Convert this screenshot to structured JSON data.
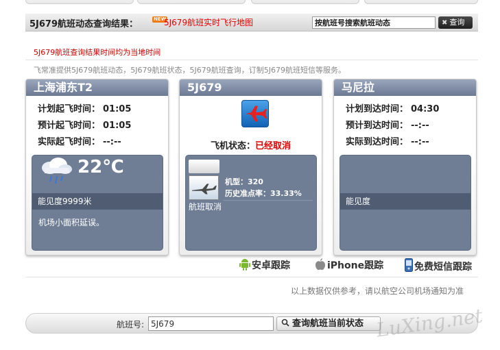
{
  "header": {
    "title": "5J679航班动态查询结果：",
    "new_badge": "NEW",
    "map_link": "5J679航班实时飞行地图",
    "search_input_value": "按航班号搜索航班动态",
    "query_button": "查询"
  },
  "notice": "5J679航班查询结果时间均为当地时间",
  "description": "飞常准提供5J679航班动态，5J679航班状态，5J679航班查询，订制5J679航班短信等服务。",
  "departure": {
    "airport": "上海浦东T2",
    "rows": [
      {
        "label": "计划起飞时间：",
        "value": "01:05"
      },
      {
        "label": "预计起飞时间：",
        "value": "01:05"
      },
      {
        "label": "实际起飞时间：",
        "value": "--:--"
      }
    ],
    "weather": {
      "temperature": "22℃",
      "visibility": "能见度9999米",
      "note": "机场小面积延误。"
    }
  },
  "flight": {
    "number": "5J679",
    "status_label": "飞机状态：",
    "status_value": "已经取消",
    "aircraft_type": "机型：320",
    "on_time_rate": "历史准点率：33.33%",
    "cancel_text": "航班取消"
  },
  "arrival": {
    "airport": "马尼拉",
    "rows": [
      {
        "label": "计划到达时间：",
        "value": "04:30"
      },
      {
        "label": "预计到达时间：",
        "value": "--:--"
      },
      {
        "label": "实际到达时间：",
        "value": "--:--"
      }
    ],
    "weather": {
      "visibility": "能见度"
    }
  },
  "tracking": {
    "android": "安卓跟踪",
    "iphone": "iPhone跟踪",
    "sms": "免费短信跟踪"
  },
  "disclaimer": "以上数据仅供参考，请以航空公司机场通知为准",
  "bottom_search": {
    "label": "航班号:",
    "value": "5J679",
    "button": "查询航班当前状态"
  },
  "watermark": "LuXing.net",
  "colors": {
    "accent_red": "#e30000",
    "panel_header": "#7d89a2",
    "panel_dark": "#6f7d95"
  }
}
